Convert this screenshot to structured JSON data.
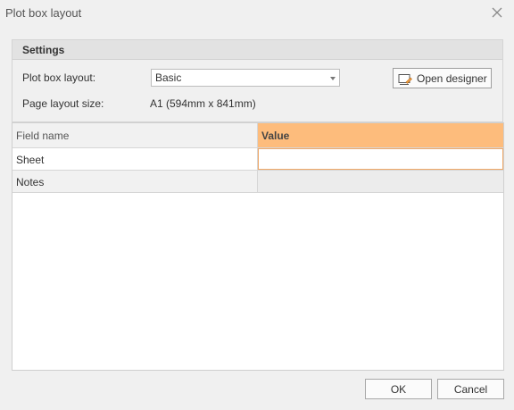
{
  "window": {
    "title": "Plot box layout"
  },
  "icons": {
    "close": "close-icon",
    "designer": "plot-box-designer-icon",
    "dropdown": "chevron-down-icon"
  },
  "colors": {
    "accent": "#fdbc7c",
    "accent_border": "#f0a868"
  },
  "settings": {
    "header": "Settings",
    "plot_box_layout_label": "Plot box layout:",
    "plot_box_layout_value": "Basic",
    "page_layout_size_label": "Page layout size:",
    "page_layout_size_value": "A1 (594mm x 841mm)",
    "open_designer_label": "Open designer"
  },
  "grid": {
    "columns": [
      "Field name",
      "Value"
    ],
    "rows": [
      {
        "field": "Sheet",
        "value": ""
      },
      {
        "field": "Notes",
        "value": ""
      }
    ]
  },
  "footer": {
    "ok_label": "OK",
    "cancel_label": "Cancel"
  }
}
